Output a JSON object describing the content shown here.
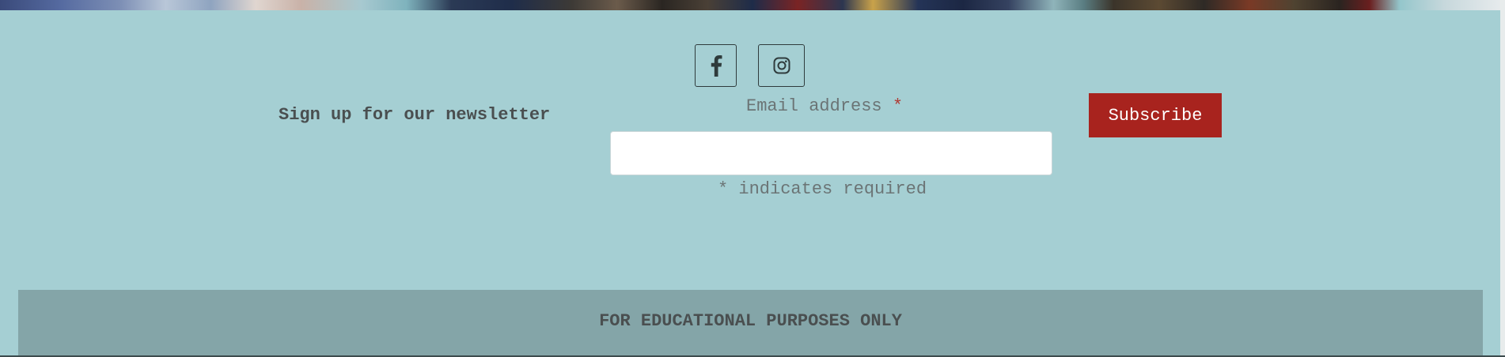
{
  "social": {
    "facebook_icon": "facebook-icon",
    "instagram_icon": "instagram-icon"
  },
  "newsletter": {
    "signup_label": "Sign up for our newsletter",
    "email_label": "Email address",
    "required_marker": "*",
    "email_value": "",
    "email_placeholder": "",
    "required_note": "* indicates required",
    "subscribe_label": "Subscribe"
  },
  "footer": {
    "text": "FOR EDUCATIONAL PURPOSES ONLY"
  },
  "colors": {
    "background": "#a5cfd3",
    "footer_bar": "#84a5a8",
    "subscribe_button": "#a8231e",
    "required_star": "#b03a33"
  }
}
